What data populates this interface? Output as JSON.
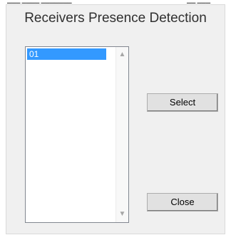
{
  "dialog": {
    "title": "Receivers Presence Detection"
  },
  "receivers": {
    "items": [
      {
        "label": "01",
        "selected": true
      }
    ],
    "scroll_up_icon": "chevron-up",
    "scroll_down_icon": "chevron-down"
  },
  "buttons": {
    "select_label": "Select",
    "close_label": "Close"
  },
  "colors": {
    "selection": "#3399ff",
    "dialog_background": "#f0f0f0"
  }
}
